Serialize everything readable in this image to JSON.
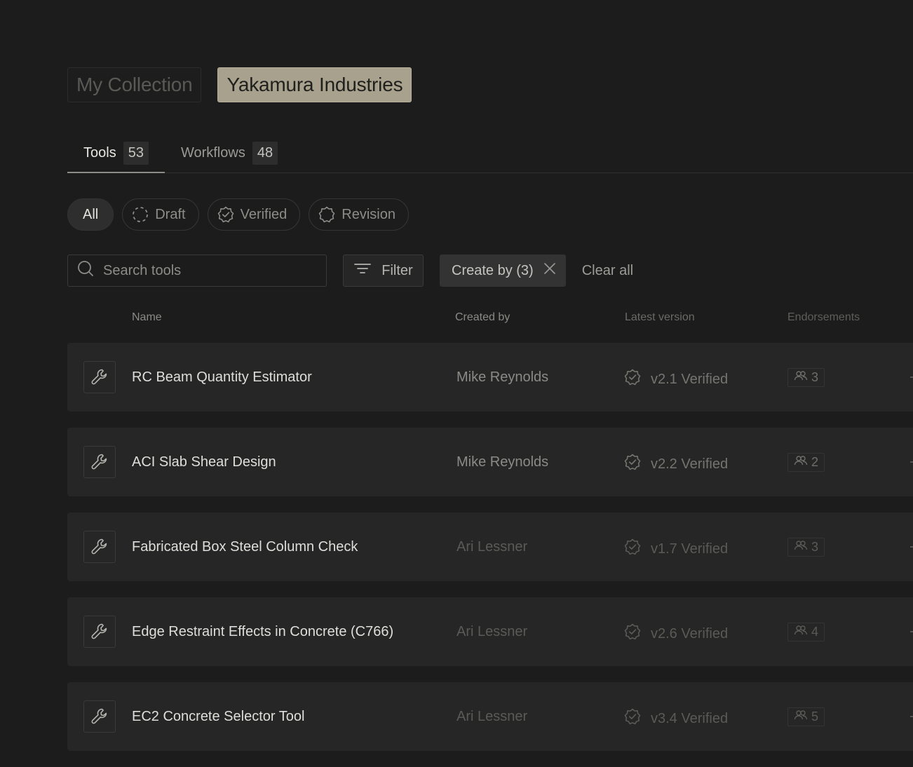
{
  "collections": {
    "items": [
      {
        "label": "My Collection",
        "active": false
      },
      {
        "label": "Yakamura Industries",
        "active": true
      }
    ]
  },
  "tabs": [
    {
      "label": "Tools",
      "count": "53",
      "active": true
    },
    {
      "label": "Workflows",
      "count": "48",
      "active": false
    }
  ],
  "status_filters": {
    "all": "All",
    "draft": "Draft",
    "verified": "Verified",
    "revision": "Revision"
  },
  "toolbar": {
    "search_placeholder": "Search tools",
    "filter_label": "Filter",
    "active_chip": "Create by (3)",
    "clear_all": "Clear all"
  },
  "table": {
    "columns": {
      "name": "Name",
      "created_by": "Created by",
      "latest_version": "Latest version",
      "endorsements": "Endorsements"
    },
    "rows": [
      {
        "name": "RC Beam Quantity Estimator",
        "created_by": "Mike Reynolds",
        "version": "v2.1 Verified",
        "endorsements": "3"
      },
      {
        "name": "ACI Slab Shear Design",
        "created_by": "Mike Reynolds",
        "version": "v2.2 Verified",
        "endorsements": "2"
      },
      {
        "name": "Fabricated Box Steel Column Check",
        "created_by": "Ari Lessner",
        "version": "v1.7 Verified",
        "endorsements": "3"
      },
      {
        "name": "Edge Restraint Effects in Concrete (C766)",
        "created_by": "Ari Lessner",
        "version": "v2.6 Verified",
        "endorsements": "4"
      },
      {
        "name": "EC2 Concrete Selector Tool",
        "created_by": "Ari Lessner",
        "version": "v3.4 Verified",
        "endorsements": "5"
      }
    ]
  },
  "colors": {
    "background": "#1c1c1c",
    "accent": "#a7a18d",
    "row_background": "#262626"
  },
  "icons": {
    "tool": "wrench-icon",
    "search": "search-icon",
    "filter": "filter-icon",
    "close": "close-icon",
    "verified": "verified-badge-icon",
    "draft": "dashed-circle-icon",
    "revision": "badge-outline-icon",
    "endorsements": "users-icon"
  }
}
